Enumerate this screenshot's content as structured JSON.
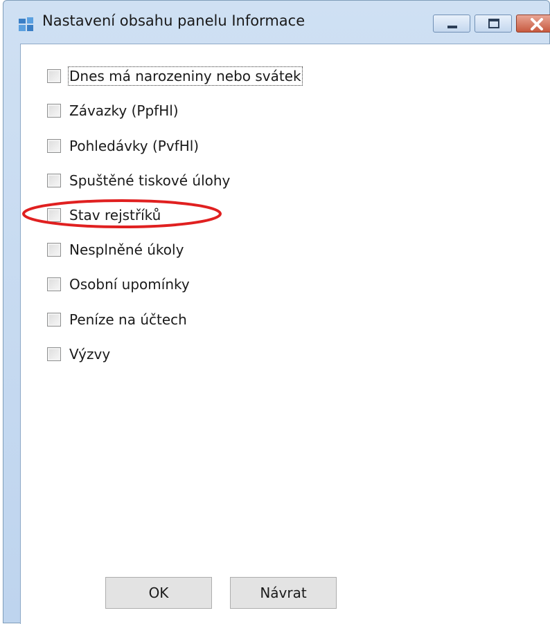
{
  "window": {
    "title": "Nastavení obsahu panelu Informace",
    "icon": "app-window-icon"
  },
  "checkboxes": [
    {
      "label": "Dnes má narozeniny nebo svátek",
      "checked": false,
      "focused": true
    },
    {
      "label": "Závazky (PpfHl)",
      "checked": false
    },
    {
      "label": "Pohledávky (PvfHl)",
      "checked": false
    },
    {
      "label": "Spuštěné tiskové úlohy",
      "checked": false
    },
    {
      "label": "Stav rejstříků",
      "checked": false,
      "highlighted": true
    },
    {
      "label": "Nesplněné úkoly",
      "checked": false
    },
    {
      "label": "Osobní upomínky",
      "checked": false
    },
    {
      "label": "Peníze na účtech",
      "checked": false
    },
    {
      "label": "Výzvy",
      "checked": false
    }
  ],
  "buttons": {
    "ok_label": "OK",
    "back_label": "Návrat"
  },
  "colors": {
    "highlight_ellipse": "#e02020",
    "titlebar": "#c4d8f0",
    "close_button": "#c75a40"
  }
}
